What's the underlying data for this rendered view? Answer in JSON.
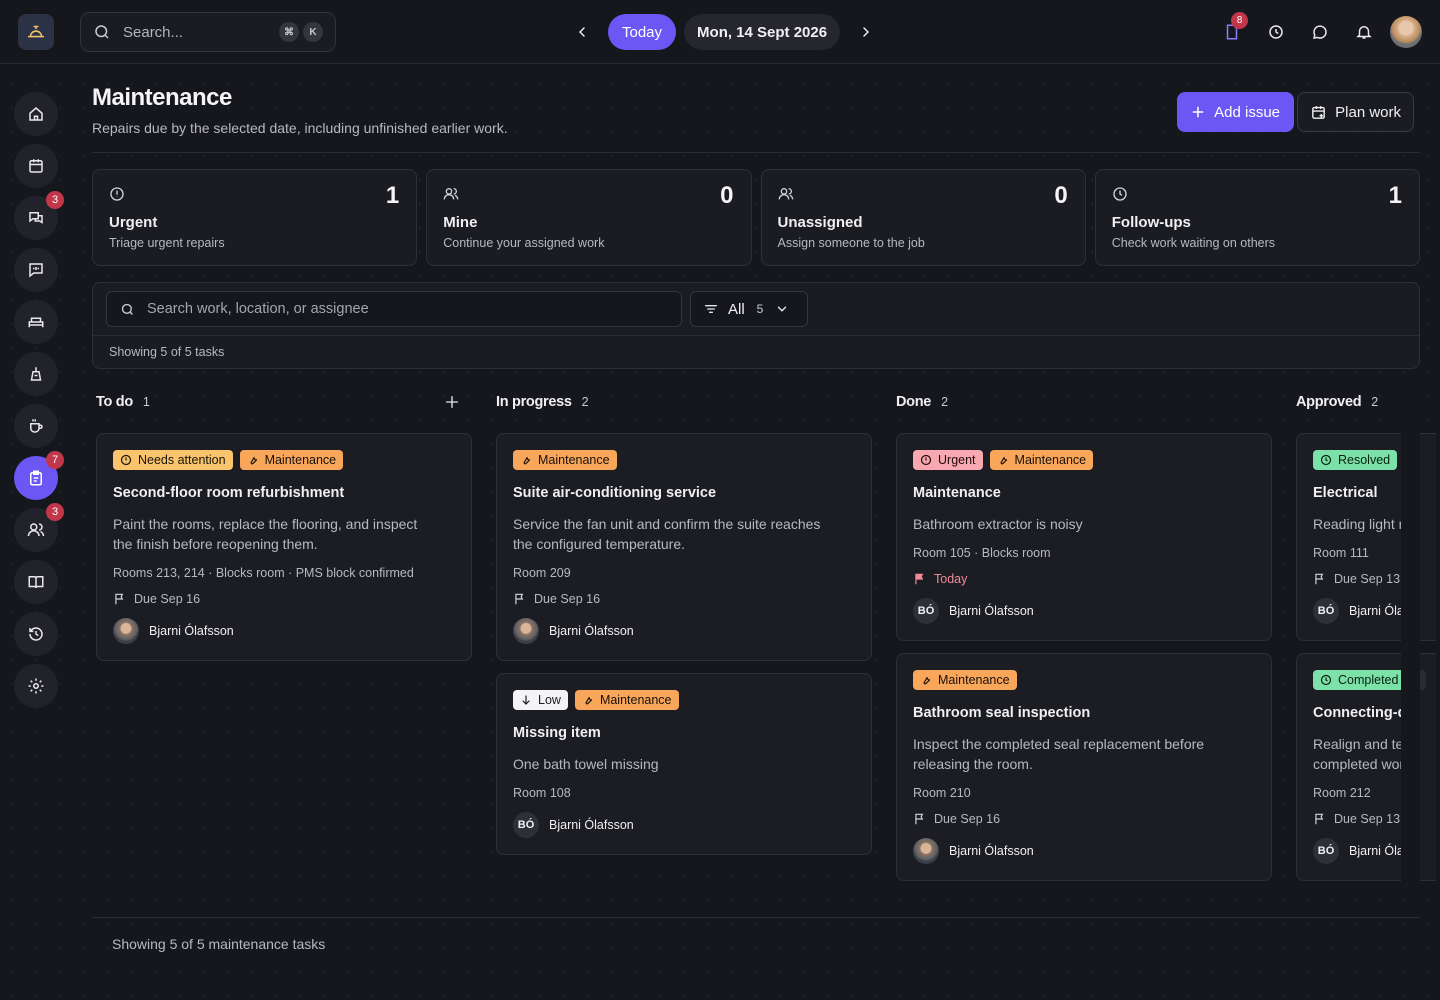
{
  "topbar": {
    "search_placeholder": "Search...",
    "shortcut_keys": [
      "⌘",
      "K"
    ],
    "today_label": "Today",
    "date_label": "Mon, 14 Sept 2026",
    "docs_badge": "8"
  },
  "sidebar": {
    "badges": {
      "messages": "3",
      "maintenance": "7",
      "staff": "3"
    }
  },
  "page": {
    "title": "Maintenance",
    "subtitle": "Repairs due by the selected date, including unfinished earlier work.",
    "add_issue_label": "Add issue",
    "plan_work_label": "Plan work"
  },
  "stats": [
    {
      "count": "1",
      "label": "Urgent",
      "desc": "Triage urgent repairs",
      "icon": "alert-circle-icon"
    },
    {
      "count": "0",
      "label": "Mine",
      "desc": "Continue your assigned work",
      "icon": "users-icon"
    },
    {
      "count": "0",
      "label": "Unassigned",
      "desc": "Assign someone to the job",
      "icon": "users-icon"
    },
    {
      "count": "1",
      "label": "Follow-ups",
      "desc": "Check work waiting on others",
      "icon": "clock-icon"
    }
  ],
  "filters": {
    "search_placeholder": "Search work, location, or assignee",
    "select_value": "All",
    "select_count": "5",
    "showing": "Showing 5 of 5 tasks"
  },
  "columns": [
    {
      "name": "To do",
      "count": "1",
      "cards": [
        {
          "tags": [
            {
              "type": "attn",
              "label": "Needs attention",
              "icon": "alert-circle-icon"
            },
            {
              "type": "maint",
              "label": "Maintenance",
              "icon": "wrench-icon"
            }
          ],
          "title": "Second-floor room refurbishment",
          "desc": "Paint the rooms, replace the flooring, and inspect\nthe finish before reopening them.",
          "meta": "Rooms 213, 214 · Blocks room · PMS block confirmed",
          "due": "Due Sep 16",
          "assignee": "Bjarni Ólafsson",
          "avatar": "photo"
        }
      ]
    },
    {
      "name": "In progress",
      "count": "2",
      "cards": [
        {
          "tags": [
            {
              "type": "maint",
              "label": "Maintenance",
              "icon": "wrench-icon"
            }
          ],
          "title": "Suite air-conditioning service",
          "desc": "Service the fan unit and confirm the suite reaches\nthe configured temperature.",
          "meta": "Room 209",
          "due": "Due Sep 16",
          "assignee": "Bjarni Ólafsson",
          "avatar": "photo"
        },
        {
          "tags": [
            {
              "type": "low",
              "label": "Low",
              "icon": "arrow-down-icon"
            },
            {
              "type": "maint",
              "label": "Maintenance",
              "icon": "wrench-icon"
            }
          ],
          "title": "Missing item",
          "desc": "One bath towel missing",
          "meta": "Room 108",
          "assignee": "Bjarni Ólafsson",
          "avatar": "initials",
          "initials": "BÓ"
        }
      ]
    },
    {
      "name": "Done",
      "count": "2",
      "cards": [
        {
          "tags": [
            {
              "type": "urg",
              "label": "Urgent",
              "icon": "alert-circle-icon"
            },
            {
              "type": "maint",
              "label": "Maintenance",
              "icon": "wrench-icon"
            }
          ],
          "title": "Maintenance",
          "desc": "Bathroom extractor is noisy",
          "meta": "Room 105 · Blocks room",
          "due": "Today",
          "due_today": true,
          "assignee": "Bjarni Ólafsson",
          "avatar": "initials",
          "initials": "BÓ"
        },
        {
          "tags": [
            {
              "type": "maint",
              "label": "Maintenance",
              "icon": "wrench-icon"
            }
          ],
          "title": "Bathroom seal inspection",
          "desc": "Inspect the completed seal replacement before\nreleasing the room.",
          "meta": "Room 210",
          "due": "Due Sep 16",
          "assignee": "Bjarni Ólafsson",
          "avatar": "photo"
        }
      ]
    },
    {
      "name": "Approved",
      "count": "2",
      "cards": [
        {
          "tags": [
            {
              "type": "res",
              "label": "Resolved",
              "icon": "clock-icon"
            },
            {
              "type": "maint",
              "label": "",
              "icon": ""
            }
          ],
          "title": "Electrical",
          "desc": "Reading light re",
          "meta": "Room 111",
          "due": "Due Sep 13",
          "assignee": "Bjarni Ólafs",
          "avatar": "initials",
          "initials": "BÓ"
        },
        {
          "tags": [
            {
              "type": "res",
              "label": "Completed",
              "icon": "clock-icon"
            },
            {
              "type": "maint",
              "label": "",
              "icon": ""
            }
          ],
          "title": "Connecting-do",
          "desc": "Realign and test\ncompleted work",
          "meta": "Room 212",
          "due": "Due Sep 13",
          "assignee": "Bjarni Ólafs",
          "avatar": "initials",
          "initials": "BÓ"
        }
      ]
    }
  ],
  "footer": "Showing 5 of 5 maintenance tasks",
  "colors": {
    "accent": "#6c57f5",
    "badge": "#c2364a",
    "background": "#16171d"
  }
}
